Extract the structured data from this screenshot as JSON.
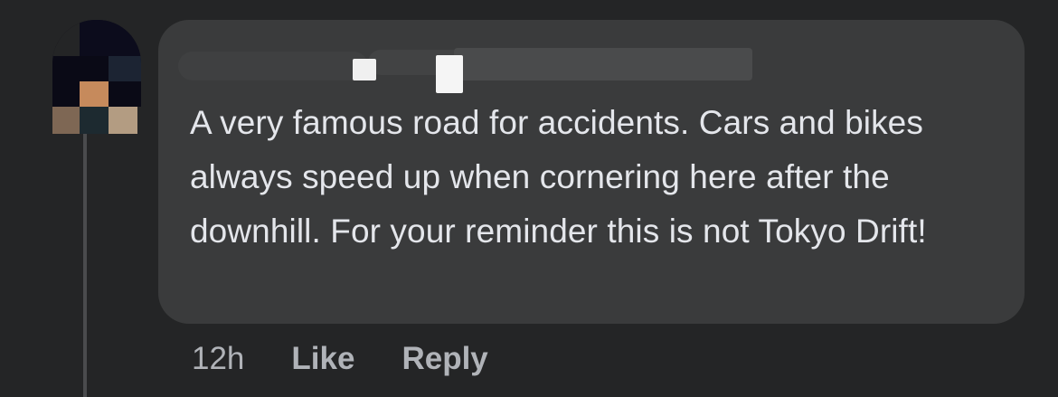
{
  "comment": {
    "author": "",
    "text": "A very famous road for accidents. Cars and bikes always speed up when cornering here after the downhill. For your reminder this is not Tokyo Drift!",
    "timestamp": "12h",
    "like_label": "Like",
    "reply_label": "Reply"
  },
  "colors": {
    "background": "#242526",
    "bubble": "#3a3b3c",
    "text": "#e4e6eb",
    "secondary_text": "#b0b3b8"
  }
}
